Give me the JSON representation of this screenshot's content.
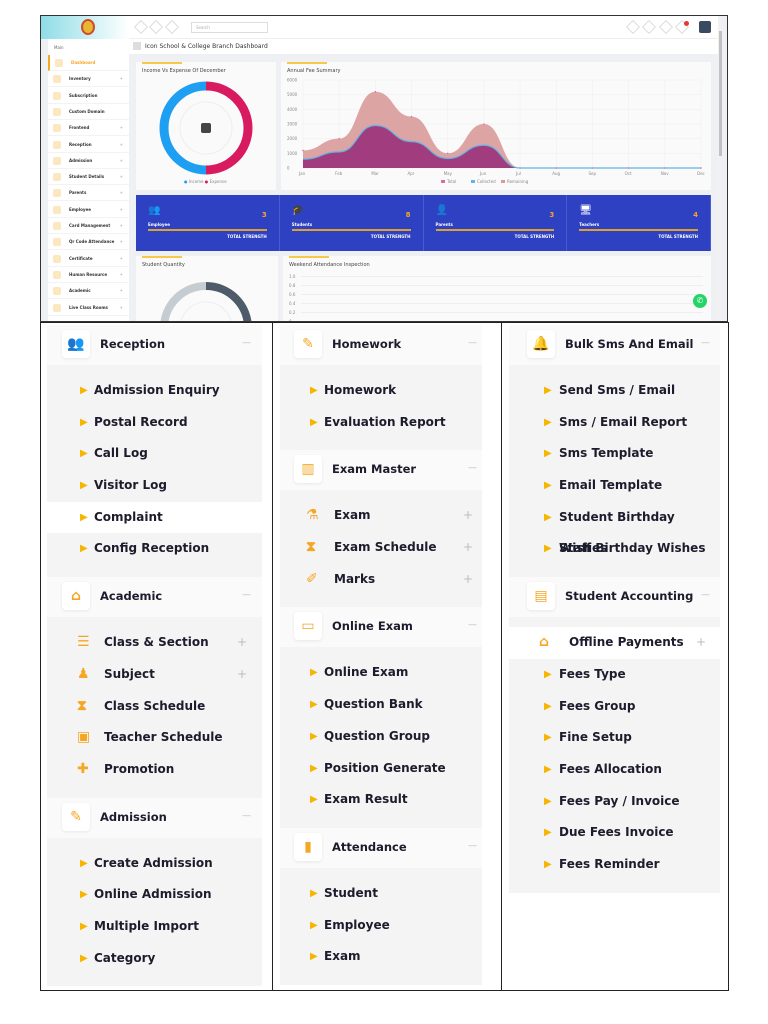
{
  "header": {
    "search_placeholder": "Search",
    "notification_count": "1"
  },
  "sidebar": {
    "section": "Main",
    "items": [
      "Dashboard",
      "Inventory",
      "Subscription",
      "Custom Domain",
      "Frontend",
      "Reception",
      "Admission",
      "Student Details",
      "Parents",
      "Employee",
      "Card Management",
      "Qr Code Attendance",
      "Certificate",
      "Human Resource",
      "Academic",
      "Live Class Rooms"
    ]
  },
  "breadcrumb": "Icon School & College Branch Dashboard",
  "income_chart": {
    "title": "Income Vs Expense Of December",
    "legend": [
      "Income",
      "Expense"
    ],
    "colors": [
      "#1e9ff2",
      "#d81b60"
    ],
    "values": [
      50,
      50
    ]
  },
  "chart_data": {
    "type": "area",
    "title": "Annual Fee Summary",
    "categories": [
      "Jan",
      "Feb",
      "Mar",
      "Apr",
      "May",
      "Jun",
      "Jul",
      "Aug",
      "Sep",
      "Oct",
      "Nov",
      "Dec"
    ],
    "ylim": [
      0,
      6000
    ],
    "yticks": [
      "6000",
      "5000",
      "4000",
      "3000",
      "2000",
      "1000",
      "0"
    ],
    "series": [
      {
        "name": "Total",
        "color": "#e06c9f",
        "values": [
          1200,
          2000,
          5200,
          3500,
          1000,
          3000,
          0,
          0,
          0,
          0,
          0,
          0
        ]
      },
      {
        "name": "Collected",
        "color": "#5fb3e6",
        "values": [
          600,
          1100,
          2900,
          1800,
          650,
          1550,
          0,
          0,
          0,
          0,
          0,
          0
        ]
      },
      {
        "name": "Remaining",
        "color": "#d99a9a",
        "values": [
          600,
          900,
          2300,
          1700,
          350,
          1450,
          0,
          0,
          0,
          0,
          0,
          0
        ]
      }
    ]
  },
  "stats": [
    {
      "label": "Employee",
      "value": "3",
      "footer": "TOTAL STRENGTH",
      "icon": "users-icon"
    },
    {
      "label": "Students",
      "value": "8",
      "footer": "TOTAL STRENGTH",
      "icon": "graduate-icon"
    },
    {
      "label": "Parents",
      "value": "3",
      "footer": "TOTAL STRENGTH",
      "icon": "parent-icon"
    },
    {
      "label": "Teachers",
      "value": "4",
      "footer": "TOTAL STRENGTH",
      "icon": "teacher-icon"
    }
  ],
  "student_quantity": {
    "title": "Student Quantity"
  },
  "weekend_attendance": {
    "title": "Weekend Attendance Inspection",
    "yticks": [
      "1.0",
      "0.8",
      "0.6",
      "0.4",
      "0.2",
      "0"
    ]
  },
  "menus": [
    [
      {
        "title": "Reception",
        "icon": "👥",
        "items": [
          {
            "label": "Admission Enquiry"
          },
          {
            "label": "Postal Record"
          },
          {
            "label": "Call Log"
          },
          {
            "label": "Visitor Log"
          },
          {
            "label": "Complaint",
            "white": true
          },
          {
            "label": "Config Reception"
          }
        ]
      },
      {
        "title": "Academic",
        "icon": "⌂",
        "items": [
          {
            "label": "Class & Section",
            "glyph": "☰",
            "plus": true
          },
          {
            "label": "Subject",
            "glyph": "♟",
            "plus": true
          },
          {
            "label": "Class Schedule",
            "glyph": "⧗"
          },
          {
            "label": "Teacher Schedule",
            "glyph": "▣"
          },
          {
            "label": "Promotion",
            "glyph": "✚"
          }
        ]
      },
      {
        "title": "Admission",
        "icon": "✎",
        "items": [
          {
            "label": "Create Admission"
          },
          {
            "label": "Online Admission"
          },
          {
            "label": "Multiple Import"
          },
          {
            "label": "Category"
          }
        ]
      }
    ],
    [
      {
        "title": "Homework",
        "icon": "✎",
        "items": [
          {
            "label": "Homework"
          },
          {
            "label": "Evaluation Report"
          }
        ]
      },
      {
        "title": "Exam Master",
        "icon": "▥",
        "items": [
          {
            "label": "Exam",
            "glyph": "⚗",
            "plus": true
          },
          {
            "label": "Exam Schedule",
            "glyph": "⧗",
            "plus": true
          },
          {
            "label": "Marks",
            "glyph": "✐",
            "plus": true
          }
        ]
      },
      {
        "title": "Online Exam",
        "icon": "▭",
        "items": [
          {
            "label": "Online Exam"
          },
          {
            "label": "Question Bank"
          },
          {
            "label": "Question Group"
          },
          {
            "label": "Position Generate"
          },
          {
            "label": "Exam Result"
          }
        ]
      },
      {
        "title": "Attendance",
        "icon": "▮",
        "items": [
          {
            "label": "Student"
          },
          {
            "label": "Employee"
          },
          {
            "label": "Exam"
          }
        ]
      }
    ],
    [
      {
        "title": "Bulk Sms And Email",
        "icon": "🔔",
        "items": [
          {
            "label": "Send Sms / Email"
          },
          {
            "label": "Sms / Email Report"
          },
          {
            "label": "Sms Template"
          },
          {
            "label": "Email Template"
          },
          {
            "label": "Student Birthday Wishes"
          },
          {
            "label": "Staff Birthday Wishes"
          }
        ]
      },
      {
        "title": "Student Accounting",
        "icon": "▤",
        "items": [
          {
            "label": "Offline Payments",
            "glyph": "⌂",
            "plus": true,
            "white": true
          },
          {
            "label": "Fees Type"
          },
          {
            "label": "Fees Group"
          },
          {
            "label": "Fine Setup"
          },
          {
            "label": "Fees Allocation"
          },
          {
            "label": "Fees Pay / Invoice"
          },
          {
            "label": "Due Fees Invoice"
          },
          {
            "label": "Fees Reminder"
          }
        ]
      }
    ]
  ]
}
